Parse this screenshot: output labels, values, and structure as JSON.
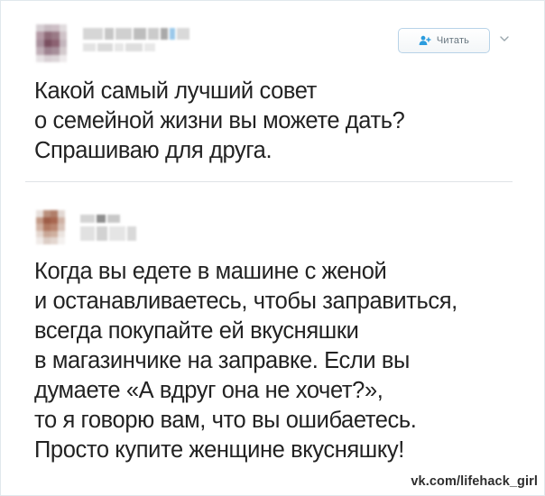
{
  "tweets": [
    {
      "follow_label": "Читать",
      "text": "Какой самый лучший совет\nо семейной жизни вы можете дать?\nСпрашиваю для друга."
    },
    {
      "text": "Когда вы едете в машине с женой\nи останавливаетесь, чтобы заправиться,\nвсегда покупайте ей вкусняшки\nв магазинчике на заправке. Если вы\nдумаете «А вдруг она не хочет?»,\nто я говорю вам, что вы ошибаетесь.\nПросто купите женщине вкусняшку!"
    }
  ],
  "watermark": "vk.com/lifehack_girl",
  "colors": {
    "follow_accent": "#2b9cde",
    "text": "#222222",
    "border": "#e1e8ed"
  },
  "icons": {
    "follow": "add-user-icon",
    "menu": "chevron-down-icon"
  }
}
